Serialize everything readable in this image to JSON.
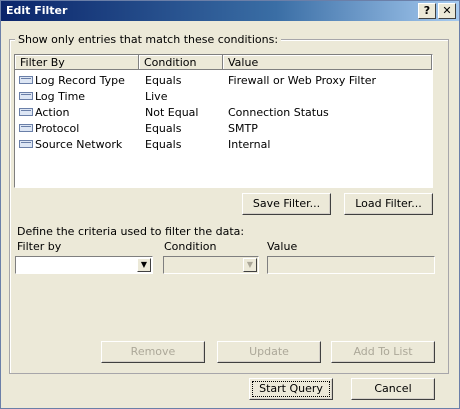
{
  "window": {
    "title": "Edit Filter",
    "help_label": "?",
    "close_label": "✕"
  },
  "conditions": {
    "group_label": "Show only entries that match these conditions:",
    "columns": [
      "Filter By",
      "Condition",
      "Value"
    ],
    "rows": [
      {
        "filter_by": "Log Record Type",
        "condition": "Equals",
        "value": "Firewall or Web Proxy Filter"
      },
      {
        "filter_by": "Log Time",
        "condition": "Live",
        "value": ""
      },
      {
        "filter_by": "Action",
        "condition": "Not Equal",
        "value": "Connection Status"
      },
      {
        "filter_by": "Protocol",
        "condition": "Equals",
        "value": "SMTP"
      },
      {
        "filter_by": "Source Network",
        "condition": "Equals",
        "value": "Internal"
      }
    ]
  },
  "buttons": {
    "save_filter": "Save Filter...",
    "load_filter": "Load Filter...",
    "remove": "Remove",
    "update": "Update",
    "add_to_list": "Add To List",
    "start_query": "Start Query",
    "cancel": "Cancel"
  },
  "criteria": {
    "label": "Define the criteria used to filter the data:",
    "filter_by_label": "Filter by",
    "condition_label": "Condition",
    "value_label": "Value",
    "filter_by_value": "",
    "condition_value": "",
    "value_value": ""
  },
  "icons": {
    "row_icon": "log-record-icon",
    "dropdown": "chevron-down-icon"
  }
}
